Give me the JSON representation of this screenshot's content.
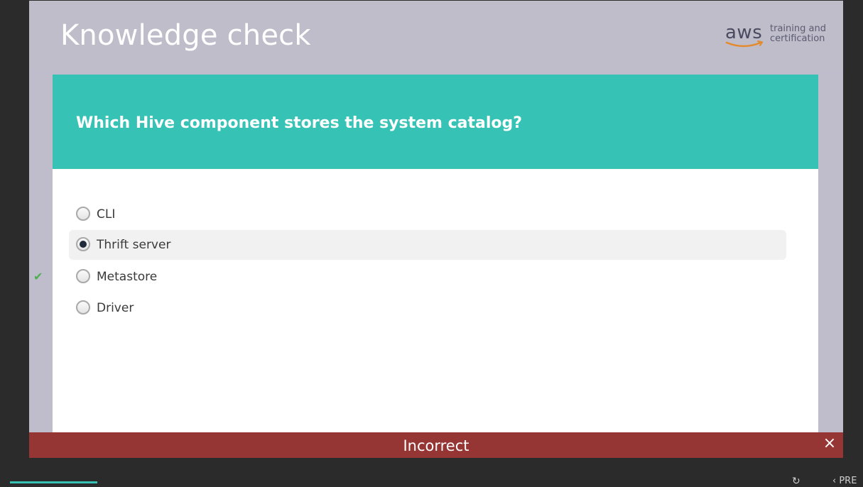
{
  "slide": {
    "title": "Knowledge check",
    "logo": {
      "brand": "aws",
      "tagline_line1": "training and",
      "tagline_line2": "certification"
    }
  },
  "question": {
    "text": "Which Hive component stores the system catalog?"
  },
  "choices": [
    {
      "label": "CLI",
      "selected": false,
      "correct": false
    },
    {
      "label": "Thrift server",
      "selected": true,
      "correct": false
    },
    {
      "label": "Metastore",
      "selected": false,
      "correct": true
    },
    {
      "label": "Driver",
      "selected": false,
      "correct": false
    }
  ],
  "feedback": {
    "text": "Incorrect",
    "close_icon": "×"
  },
  "footer": {
    "prev_label": "PRE"
  },
  "colors": {
    "question_band": "#36c3b6",
    "feedback_incorrect": "#963634",
    "correct_check": "#4caf50"
  }
}
